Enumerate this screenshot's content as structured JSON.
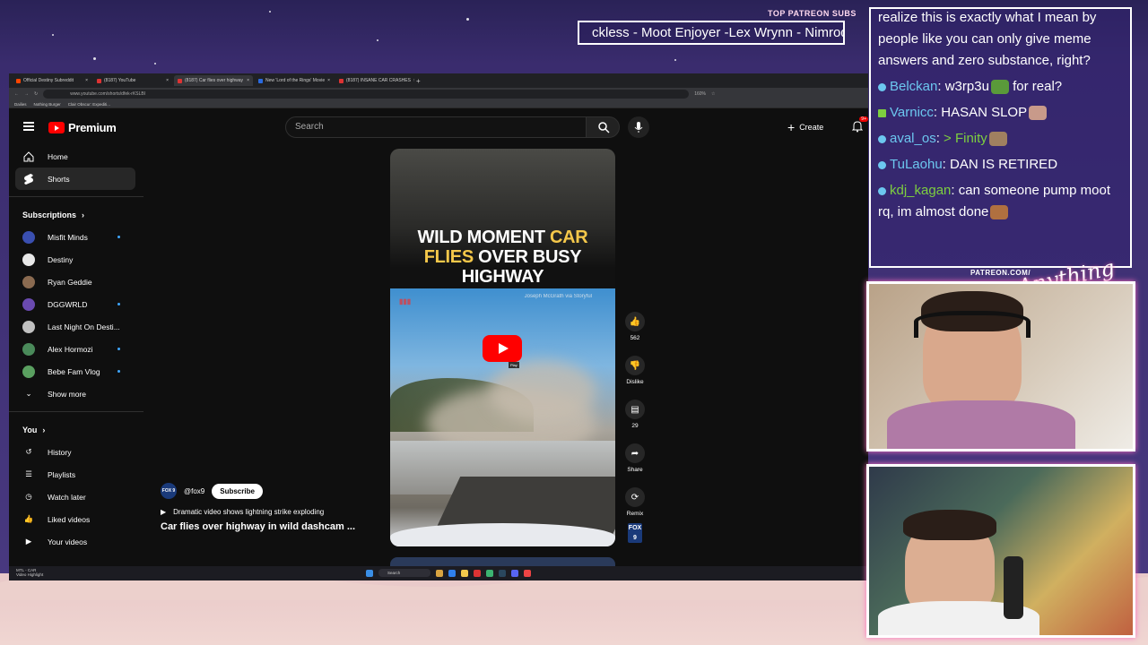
{
  "overlay": {
    "patreon_label": "TOP PATREON SUBS",
    "ticker_text": "ckless - Moot Enjoyer -Lex Wrynn - Nimrod",
    "patreon_url": "PATREON.COM/",
    "signature": "Anything Else?"
  },
  "browser": {
    "tabs": [
      {
        "label": "Official Destiny Subreddit",
        "active": false
      },
      {
        "label": "(8187) YouTube",
        "active": false
      },
      {
        "label": "(8187) Car flies over highway",
        "active": true
      },
      {
        "label": "New 'Lord of the Rings' Movie",
        "active": false
      },
      {
        "label": "(8187) INSANE CAR CRASHES",
        "active": false
      }
    ],
    "url": "www.youtube.com/shorts/dfek-rKSLBI",
    "zoom": "160%",
    "bookmarks": [
      "Dailies",
      "Nothing Burger",
      "Clair Obscur: Expediti..."
    ]
  },
  "youtube": {
    "logo_text": "Premium",
    "search_placeholder": "Search",
    "create_label": "Create",
    "notification_count": "9+",
    "nav": [
      {
        "label": "Home",
        "icon": "home-icon",
        "active": false
      },
      {
        "label": "Shorts",
        "icon": "shorts-icon",
        "active": true
      }
    ],
    "subscriptions_title": "Subscriptions",
    "subscriptions": [
      {
        "label": "Misfit Minds",
        "new": true,
        "color": "#3a4fb0"
      },
      {
        "label": "Destiny",
        "new": false,
        "color": "#e8e8e8"
      },
      {
        "label": "Ryan Geddie",
        "new": false,
        "color": "#8a6a50"
      },
      {
        "label": "DGGWRLD",
        "new": true,
        "color": "#6a4ab0"
      },
      {
        "label": "Last Night On Desti...",
        "new": false,
        "color": "#c0c0c0"
      },
      {
        "label": "Alex Hormozi",
        "new": true,
        "color": "#4a8a5a"
      },
      {
        "label": "Bebe Fam Vlog",
        "new": true,
        "color": "#5aa060"
      }
    ],
    "show_more": "Show more",
    "you_title": "You",
    "you_items": [
      {
        "label": "History",
        "icon": "history-icon"
      },
      {
        "label": "Playlists",
        "icon": "playlists-icon"
      },
      {
        "label": "Watch later",
        "icon": "clock-icon"
      },
      {
        "label": "Liked videos",
        "icon": "thumbs-up-icon"
      },
      {
        "label": "Your videos",
        "icon": "video-icon"
      }
    ],
    "short": {
      "headline_line1_white": "WILD MOMENT ",
      "headline_line1_yellow": "CAR",
      "headline_line2_yellow": "FLIES",
      "headline_line2_white": " OVER BUSY",
      "headline_line3": "HIGHWAY",
      "credit": "Joseph McGrath via Storyful",
      "tooltip": "Play",
      "likes": "562",
      "dislike_label": "Dislike",
      "comments": "29",
      "share_label": "Share",
      "remix_label": "Remix",
      "channel_logo": "FOX 9",
      "channel_handle": "@fox9",
      "subscribe_label": "Subscribe",
      "playlist_text": "Dramatic video shows lightning strike exploding",
      "title": "Car flies over highway in wild dashcam ..."
    }
  },
  "taskbar": {
    "left_title": "MTL - CAR",
    "left_subtitle": "Video Highlight",
    "search_placeholder": "Search"
  },
  "chat": {
    "messages": [
      {
        "user": "",
        "text": "realize this is exactly what I mean by people like you can only give meme answers and zero substance, right?",
        "color": "#6cc7ef"
      },
      {
        "user": "Belckan",
        "text": ": w3rp3u",
        "suffix": " for real?",
        "color": "#6cc7ef"
      },
      {
        "user": "Varnicc",
        "text": ": HASAN SLOP",
        "color": "#6cc7ef"
      },
      {
        "user": "aval_os",
        "text": ": ",
        "highlight": "> Finity",
        "color": "#6cc7ef"
      },
      {
        "user": "TuLaohu",
        "text": ": DAN IS RETIRED",
        "color": "#6cc7ef"
      },
      {
        "user": "kdj_kagan",
        "text": ": can someone pump moot rq, im almost done",
        "color": "#7dcf3f"
      }
    ]
  }
}
